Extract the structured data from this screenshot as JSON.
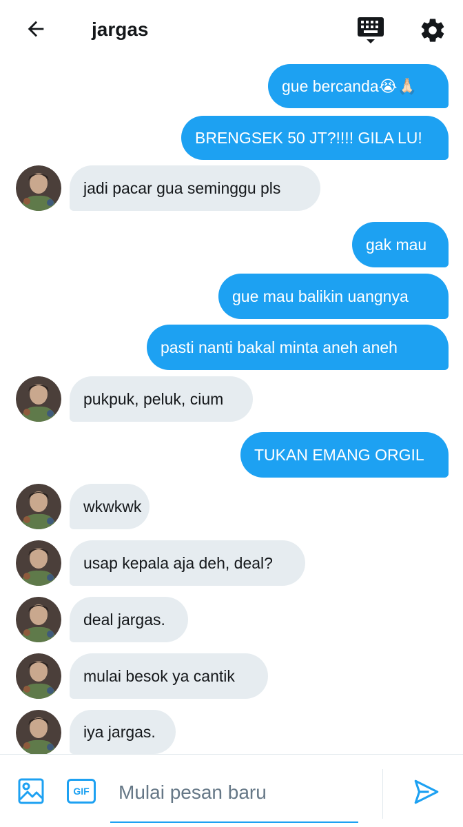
{
  "header": {
    "title": "jargas",
    "back_icon": "arrow-left-icon",
    "keyboard_icon": "keyboard-icon",
    "settings_icon": "gear-icon"
  },
  "colors": {
    "accent": "#1da1f2",
    "incoming_bubble": "#e6ecf0",
    "text": "#14171a",
    "placeholder": "#657786"
  },
  "messages": [
    {
      "direction": "out",
      "text": "gue bercanda😭🙏🏻"
    },
    {
      "direction": "out",
      "text": "BRENGSEK 50 JT?!!!! GILA LU!"
    },
    {
      "direction": "in",
      "text": "jadi pacar gua seminggu pls"
    },
    {
      "direction": "out",
      "text": "gak mau"
    },
    {
      "direction": "out",
      "text": "gue mau balikin uangnya"
    },
    {
      "direction": "out",
      "text": "pasti nanti bakal minta aneh aneh"
    },
    {
      "direction": "in",
      "text": "pukpuk, peluk, cium"
    },
    {
      "direction": "out",
      "text": "TUKAN EMANG ORGIL"
    },
    {
      "direction": "in",
      "text": "wkwkwk"
    },
    {
      "direction": "in",
      "text": "usap kepala aja deh, deal?"
    },
    {
      "direction": "in",
      "text": "deal jargas."
    },
    {
      "direction": "in",
      "text": "mulai besok ya cantik"
    },
    {
      "direction": "in",
      "text": "iya jargas."
    }
  ],
  "composer": {
    "placeholder": "Mulai pesan baru",
    "gif_label": "GIF",
    "image_icon": "image-icon",
    "send_icon": "send-icon"
  }
}
